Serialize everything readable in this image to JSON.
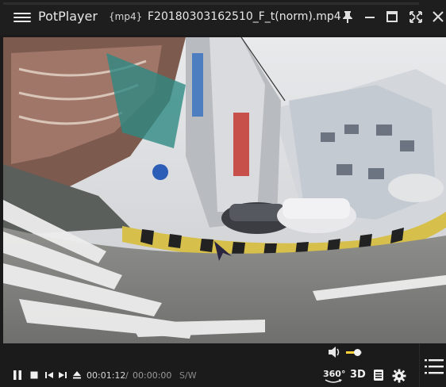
{
  "app": {
    "name": "PotPlayer",
    "format": "{mp4}",
    "file_name": "F20180303162510_F_t(norm).mp4"
  },
  "window_controls": {
    "icons": [
      "pin-icon",
      "minimize-icon",
      "maximize-icon",
      "fullscreen-icon",
      "close-icon"
    ]
  },
  "playback": {
    "current_time": "00:01:12",
    "separator": "/",
    "total_time": "00:00:00",
    "sw_label": "S/W",
    "state": "playing",
    "volume_level": 0.55
  },
  "controls": {
    "label_360": "360°",
    "label_3d": "3D"
  },
  "colors": {
    "accent": "#ffd23a",
    "background": "#1b1b1b",
    "titlebar": "#1e1e1e"
  }
}
